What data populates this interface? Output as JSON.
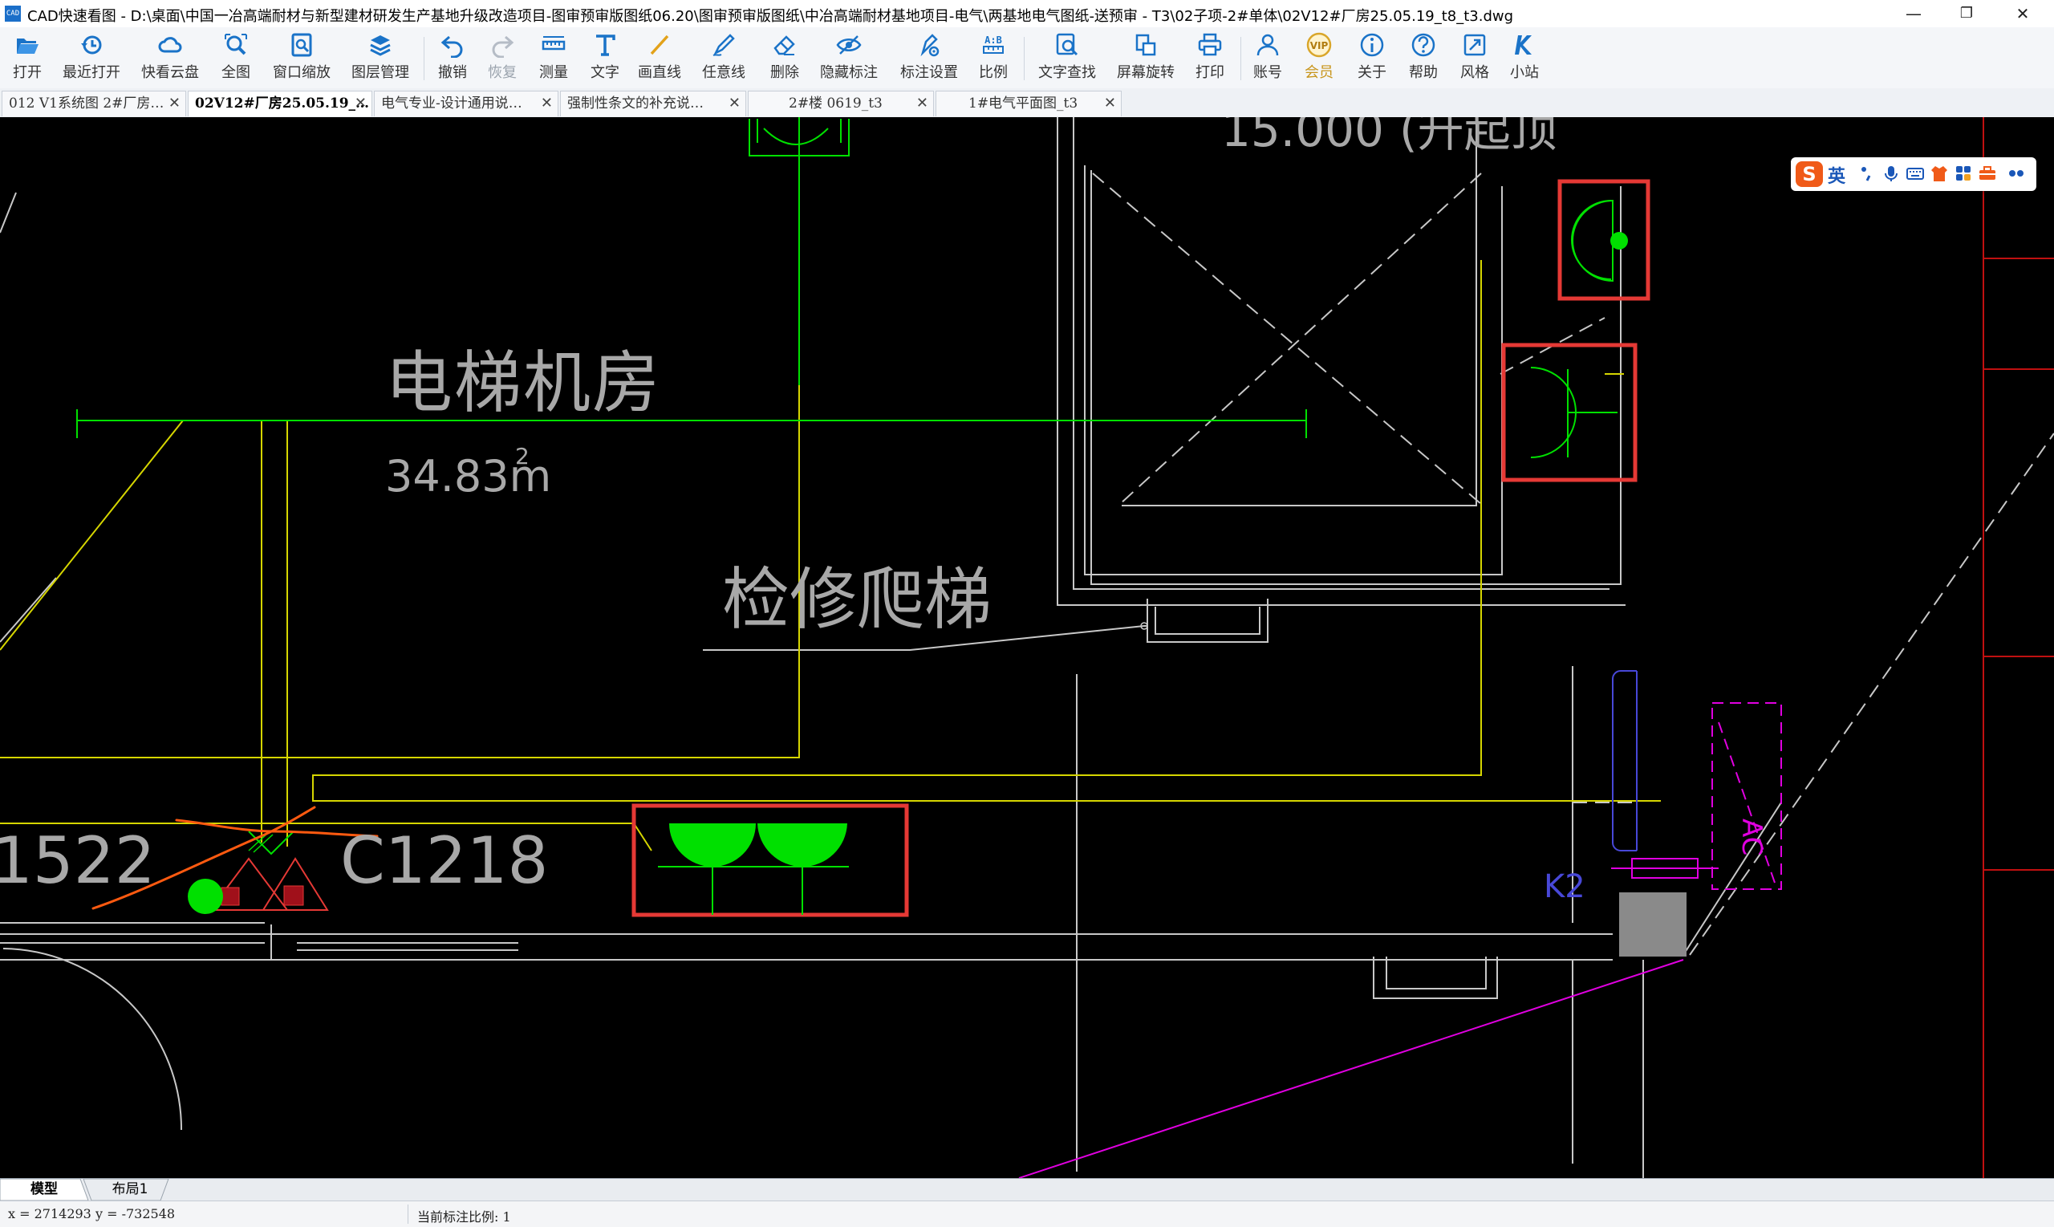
{
  "window": {
    "title": "CAD快速看图 - D:\\桌面\\中国一冶高端耐材与新型建材研发生产基地升级改造项目-图审预审版图纸06.20\\图审预审版图纸\\中冶高端耐材基地项目-电气\\两基地电气图纸-送预审 - T3\\02子项-2#单体\\02V12#厂房25.05.19_t8_t3.dwg",
    "minimize": "—",
    "maximize": "❐",
    "close": "✕"
  },
  "toolbar": [
    {
      "label": "打开",
      "icon": "folder-open-icon"
    },
    {
      "label": "最近打开",
      "icon": "history-icon"
    },
    {
      "label": "快看云盘",
      "icon": "cloud-icon"
    },
    {
      "label": "全图",
      "icon": "zoom-extents-icon"
    },
    {
      "label": "窗口缩放",
      "icon": "zoom-window-icon"
    },
    {
      "label": "图层管理",
      "icon": "layers-icon"
    },
    {
      "label": "撤销",
      "icon": "undo-icon"
    },
    {
      "label": "恢复",
      "icon": "redo-icon"
    },
    {
      "label": "测量",
      "icon": "ruler-icon"
    },
    {
      "label": "文字",
      "icon": "text-icon"
    },
    {
      "label": "画直线",
      "icon": "line-icon"
    },
    {
      "label": "任意线",
      "icon": "freehand-icon"
    },
    {
      "label": "删除",
      "icon": "eraser-icon"
    },
    {
      "label": "隐藏标注",
      "icon": "eye-hide-icon"
    },
    {
      "label": "标注设置",
      "icon": "annotation-settings-icon"
    },
    {
      "label": "比例",
      "icon": "scale-icon"
    },
    {
      "label": "文字查找",
      "icon": "text-search-icon"
    },
    {
      "label": "屏幕旋转",
      "icon": "rotate-icon"
    },
    {
      "label": "打印",
      "icon": "printer-icon"
    },
    {
      "label": "账号",
      "icon": "user-icon"
    },
    {
      "label": "会员",
      "icon": "vip-icon"
    },
    {
      "label": "关于",
      "icon": "info-icon"
    },
    {
      "label": "帮助",
      "icon": "help-icon"
    },
    {
      "label": "风格",
      "icon": "style-icon"
    },
    {
      "label": "小站",
      "icon": "site-k-icon"
    }
  ],
  "tabs": [
    {
      "label": "012 V1系统图 2#厂房…",
      "close": "✕"
    },
    {
      "label": "02V12#厂房25.05.19_…",
      "close": "✕"
    },
    {
      "label": "电气专业-设计通用说…",
      "close": "✕"
    },
    {
      "label": "强制性条文的补充说…",
      "close": "✕"
    },
    {
      "label": "2#楼 0619_t3",
      "close": "✕"
    },
    {
      "label": "1#电气平面图_t3",
      "close": "✕"
    }
  ],
  "drawing": {
    "room_name": "电梯机房",
    "room_area": "34.83m",
    "area_superscript": "2",
    "ladder_label": "检修爬梯",
    "elevation_top": "15.000",
    "top_right_text": "(升起顶",
    "left_fragment": "1522",
    "window_tag": "C1218",
    "k2_label": "K2",
    "ac_label": "AC"
  },
  "ime": {
    "lang": "英",
    "brand_letter": "S"
  },
  "layout_tabs": [
    "模型",
    "布局1"
  ],
  "status": {
    "coordinates": "x = 2714293  y = -732548",
    "scale": "当前标注比例: 1"
  },
  "colors": {
    "canvas_bg": "#000000",
    "wall_gray": "#c8c8c8",
    "yellow": "#d6d600",
    "green": "#00e000",
    "red_highlight": "#e53935",
    "magenta": "#e000e0",
    "blue": "#4848d8",
    "orange": "#ff5a10",
    "icon_blue": "#1a73c8"
  }
}
